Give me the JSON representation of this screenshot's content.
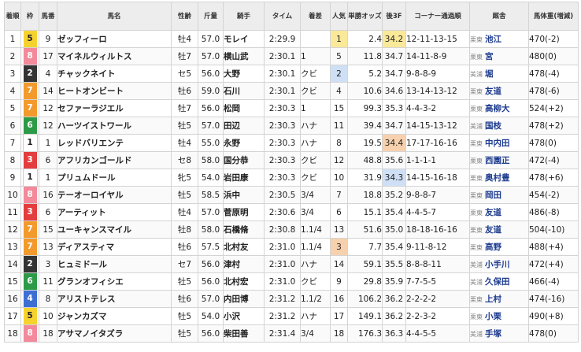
{
  "headers": {
    "rank": "着順",
    "waku": "枠",
    "umaban": "馬番",
    "name": "馬名",
    "sexage": "性齢",
    "weight": "斤量",
    "jockey": "騎手",
    "time": "タイム",
    "margin": "着差",
    "popularity": "人気",
    "odds": "単勝オッズ",
    "last3f": "後3F",
    "corner": "コーナー通過順",
    "trainer": "厩舎",
    "bodyweight": "馬体重(増減)"
  },
  "colors": {
    "waku_1": "#ffffff",
    "waku_2": "#333333",
    "waku_3": "#e33d3d",
    "waku_4": "#3d6fd3",
    "waku_5": "#f6d22e",
    "waku_6": "#2d9a47",
    "waku_7": "#f39a2c",
    "waku_8": "#f28a9b",
    "top_highlight": "#fbe99a",
    "second_highlight": "#cfe0f6",
    "third_highlight": "#f7d1ad",
    "link": "#1d3b8f",
    "odds_red": "#d0141e"
  },
  "rows": [
    {
      "rank": "1",
      "waku": "5",
      "umaban": "9",
      "name": "ゼッフィーロ",
      "sexage": "牡4",
      "weight": "57.0",
      "jockey": "モレイ",
      "time": "2:29.9",
      "margin": "",
      "pop": "1",
      "odds": "2.4",
      "last3f": "34.2",
      "corner": "12-11-13-15",
      "region": "栗東",
      "trainer": "池江",
      "bw": "470(-2)"
    },
    {
      "rank": "2",
      "waku": "8",
      "umaban": "17",
      "name": "マイネルウィルトス",
      "sexage": "牡7",
      "weight": "57.0",
      "jockey": "横山武",
      "time": "2:30.1",
      "margin": "1",
      "pop": "5",
      "odds": "11.8",
      "last3f": "34.7",
      "corner": "14-11-8-9",
      "region": "栗東",
      "trainer": "宮",
      "bw": "480(0)"
    },
    {
      "rank": "3",
      "waku": "2",
      "umaban": "4",
      "name": "チャックネイト",
      "sexage": "セ5",
      "weight": "56.0",
      "jockey": "大野",
      "time": "2:30.1",
      "margin": "クビ",
      "pop": "2",
      "odds": "5.2",
      "last3f": "34.7",
      "corner": "9-8-8-9",
      "region": "美浦",
      "trainer": "堀",
      "bw": "478(-4)"
    },
    {
      "rank": "4",
      "waku": "7",
      "umaban": "14",
      "name": "ヒートオンビート",
      "sexage": "牡6",
      "weight": "59.0",
      "jockey": "石川",
      "time": "2:30.1",
      "margin": "クビ",
      "pop": "4",
      "odds": "10.6",
      "last3f": "34.6",
      "corner": "13-14-13-12",
      "region": "栗東",
      "trainer": "友道",
      "bw": "478(-6)"
    },
    {
      "rank": "5",
      "waku": "7",
      "umaban": "12",
      "name": "セファーラジエル",
      "sexage": "牡7",
      "weight": "56.0",
      "jockey": "松岡",
      "time": "2:30.3",
      "margin": "1",
      "pop": "15",
      "odds": "99.3",
      "last3f": "35.3",
      "corner": "4-4-3-2",
      "region": "栗東",
      "trainer": "高柳大",
      "bw": "524(+2)"
    },
    {
      "rank": "6",
      "waku": "6",
      "umaban": "12",
      "name": "ハーツイストワール",
      "sexage": "牡5",
      "weight": "57.0",
      "jockey": "田辺",
      "time": "2:30.3",
      "margin": "ハナ",
      "pop": "11",
      "odds": "39.4",
      "last3f": "34.7",
      "corner": "14-15-13-12",
      "region": "美浦",
      "trainer": "国枝",
      "bw": "478(+2)"
    },
    {
      "rank": "7",
      "waku": "1",
      "umaban": "1",
      "name": "レッドバリエンテ",
      "sexage": "牡4",
      "weight": "55.0",
      "jockey": "永野",
      "time": "2:30.3",
      "margin": "ハナ",
      "pop": "8",
      "odds": "19.5",
      "last3f": "34.4",
      "corner": "17-17-16-16",
      "region": "栗東",
      "trainer": "中内田",
      "bw": "478(0)"
    },
    {
      "rank": "8",
      "waku": "3",
      "umaban": "6",
      "name": "アフリカンゴールド",
      "sexage": "セ8",
      "weight": "58.0",
      "jockey": "国分恭",
      "time": "2:30.3",
      "margin": "クビ",
      "pop": "12",
      "odds": "48.8",
      "last3f": "35.6",
      "corner": "1-1-1-1",
      "region": "栗東",
      "trainer": "西園正",
      "bw": "472(-4)"
    },
    {
      "rank": "9",
      "waku": "1",
      "umaban": "1",
      "name": "プリュムドール",
      "sexage": "牝5",
      "weight": "54.0",
      "jockey": "岩田康",
      "time": "2:30.3",
      "margin": "クビ",
      "pop": "10",
      "odds": "31.9",
      "last3f": "34.3",
      "corner": "14-15-16-18",
      "region": "栗東",
      "trainer": "奥村豊",
      "bw": "478(+6)"
    },
    {
      "rank": "10",
      "waku": "8",
      "umaban": "16",
      "name": "テーオーロイヤル",
      "sexage": "牡5",
      "weight": "58.5",
      "jockey": "浜中",
      "time": "2:30.5",
      "margin": "3/4",
      "pop": "7",
      "odds": "18.8",
      "last3f": "35.2",
      "corner": "9-8-8-7",
      "region": "栗東",
      "trainer": "岡田",
      "bw": "454(-2)"
    },
    {
      "rank": "11",
      "waku": "3",
      "umaban": "6",
      "name": "アーティット",
      "sexage": "牡4",
      "weight": "57.0",
      "jockey": "菅原明",
      "time": "2:30.6",
      "margin": "3/4",
      "pop": "6",
      "odds": "15.1",
      "last3f": "35.4",
      "corner": "4-4-5-7",
      "region": "栗東",
      "trainer": "友道",
      "bw": "486(-8)"
    },
    {
      "rank": "12",
      "waku": "7",
      "umaban": "15",
      "name": "ユーキャンスマイル",
      "sexage": "牡8",
      "weight": "58.0",
      "jockey": "石橋脩",
      "time": "2:30.8",
      "margin": "1.1/4",
      "pop": "13",
      "odds": "51.6",
      "last3f": "35.0",
      "corner": "18-18-16-16",
      "region": "栗東",
      "trainer": "友道",
      "bw": "504(-10)"
    },
    {
      "rank": "13",
      "waku": "7",
      "umaban": "13",
      "name": "ディアスティマ",
      "sexage": "牡6",
      "weight": "57.5",
      "jockey": "北村友",
      "time": "2:31.0",
      "margin": "1.1/4",
      "pop": "3",
      "odds": "7.7",
      "last3f": "35.4",
      "corner": "9-11-8-12",
      "region": "栗東",
      "trainer": "高野",
      "bw": "488(+4)"
    },
    {
      "rank": "14",
      "waku": "2",
      "umaban": "3",
      "name": "ヒュミドール",
      "sexage": "セ7",
      "weight": "56.0",
      "jockey": "津村",
      "time": "2:31.0",
      "margin": "ハナ",
      "pop": "14",
      "odds": "59.1",
      "last3f": "35.5",
      "corner": "8-8-8-11",
      "region": "美浦",
      "trainer": "小手川",
      "bw": "472(+4)"
    },
    {
      "rank": "15",
      "waku": "6",
      "umaban": "11",
      "name": "グランオフィシエ",
      "sexage": "牡5",
      "weight": "56.0",
      "jockey": "北村宏",
      "time": "2:31.0",
      "margin": "クビ",
      "pop": "9",
      "odds": "29.8",
      "last3f": "35.9",
      "corner": "7-7-5-5",
      "region": "美浦",
      "trainer": "久保田",
      "bw": "466(-4)"
    },
    {
      "rank": "16",
      "waku": "4",
      "umaban": "8",
      "name": "アリストテレス",
      "sexage": "牡6",
      "weight": "57.0",
      "jockey": "内田博",
      "time": "2:31.2",
      "margin": "1.1/2",
      "pop": "16",
      "odds": "106.2",
      "last3f": "36.2",
      "corner": "2-2-2-2",
      "region": "栗東",
      "trainer": "上村",
      "bw": "474(-16)"
    },
    {
      "rank": "17",
      "waku": "5",
      "umaban": "10",
      "name": "ジャンカズマ",
      "sexage": "牡5",
      "weight": "54.0",
      "jockey": "小沢",
      "time": "2:31.2",
      "margin": "ハナ",
      "pop": "17",
      "odds": "149.1",
      "last3f": "36.2",
      "corner": "2-2-3-2",
      "region": "栗東",
      "trainer": "小栗",
      "bw": "490(+8)"
    },
    {
      "rank": "18",
      "waku": "8",
      "umaban": "18",
      "name": "アサマノイタズラ",
      "sexage": "牡5",
      "weight": "56.0",
      "jockey": "柴田善",
      "time": "2:31.4",
      "margin": "3/4",
      "pop": "18",
      "odds": "176.3",
      "last3f": "36.3",
      "corner": "4-4-5-5",
      "region": "美浦",
      "trainer": "手塚",
      "bw": "478(0)"
    }
  ]
}
